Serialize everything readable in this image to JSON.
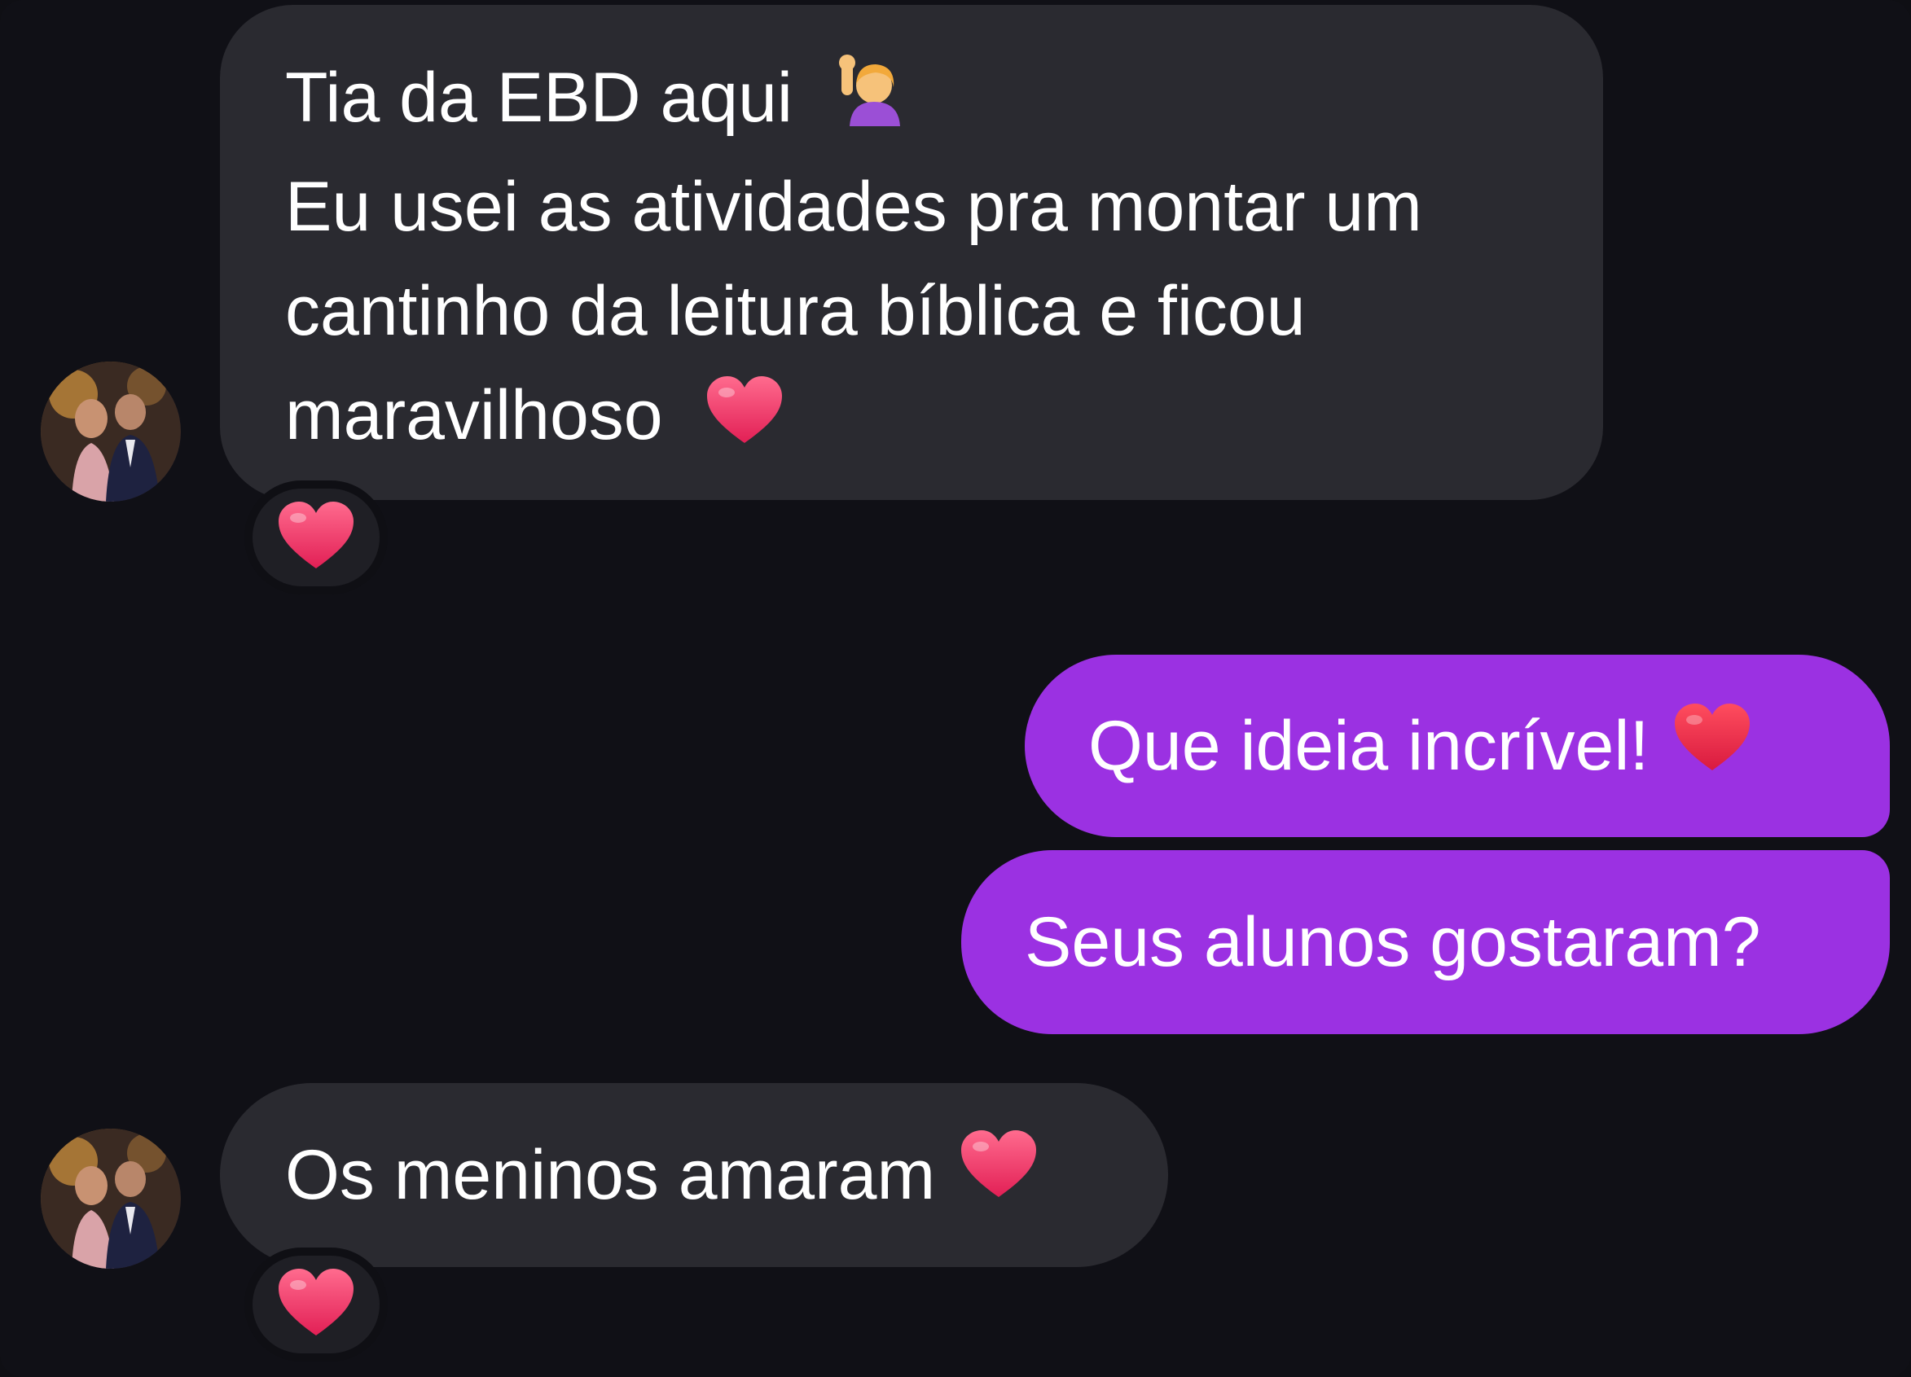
{
  "conversation": {
    "messages": [
      {
        "sender": "contact",
        "lines": [
          "Tia da EBD aqui",
          "Eu usei as atividades pra montar um",
          "cantinho da leitura bíblica e ficou",
          "maravilhoso"
        ],
        "line1_emoji": "raising-hand-woman-emoji",
        "line4_emoji": "heart-icon",
        "reaction": "heart-icon"
      },
      {
        "sender": "me",
        "text": "Que ideia incrível!",
        "emoji": "heart-icon"
      },
      {
        "sender": "me",
        "text": "Seus alunos gostaram?"
      },
      {
        "sender": "contact",
        "text": "Os meninos amaram",
        "emoji": "heart-icon",
        "reaction": "heart-icon"
      }
    ]
  },
  "colors": {
    "background": "#101016",
    "incoming_bubble": "#2a2a30",
    "outgoing_bubble": "#9b31e2",
    "text": "#ffffff",
    "heart": "#f23a6c"
  }
}
